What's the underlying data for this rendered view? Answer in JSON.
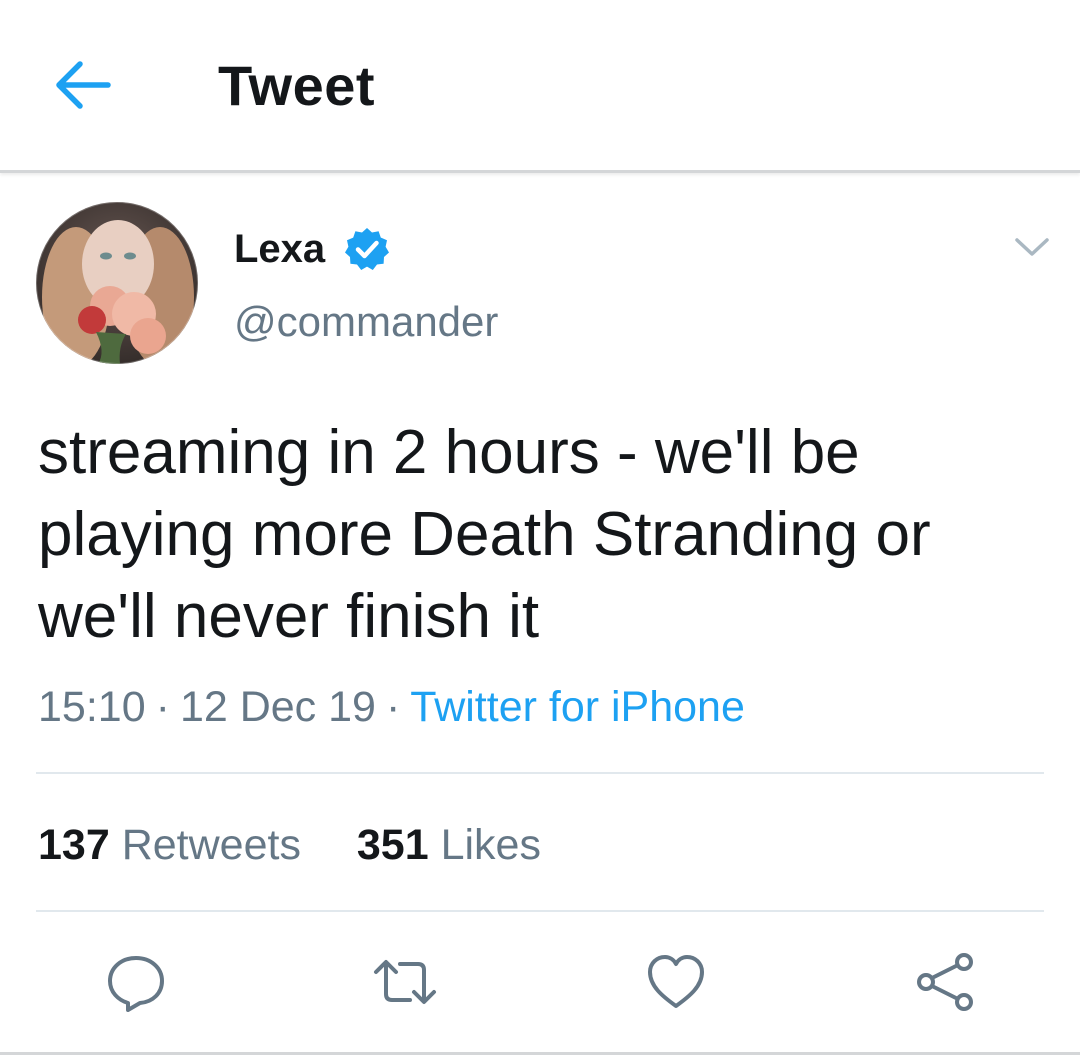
{
  "colors": {
    "accent": "#1da1f2",
    "text_primary": "#14171a",
    "text_secondary": "#657786",
    "divider": "#e1e8ed"
  },
  "header": {
    "back_icon": "arrow-left-icon",
    "title": "Tweet"
  },
  "author": {
    "display_name": "Lexa",
    "handle": "@commander",
    "verified_icon": "verified-badge-icon",
    "menu_icon": "chevron-down-icon"
  },
  "tweet": {
    "text": "streaming in 2 hours - we'll be playing more Death Stranding or we'll never finish it",
    "time": "15:10",
    "date": "12 Dec 19",
    "separator": "·",
    "source": "Twitter for iPhone"
  },
  "stats": {
    "retweets_count": "137",
    "retweets_label": "Retweets",
    "likes_count": "351",
    "likes_label": "Likes"
  },
  "actions": [
    {
      "icon": "reply-icon"
    },
    {
      "icon": "retweet-icon"
    },
    {
      "icon": "like-heart-icon"
    },
    {
      "icon": "share-icon"
    }
  ]
}
